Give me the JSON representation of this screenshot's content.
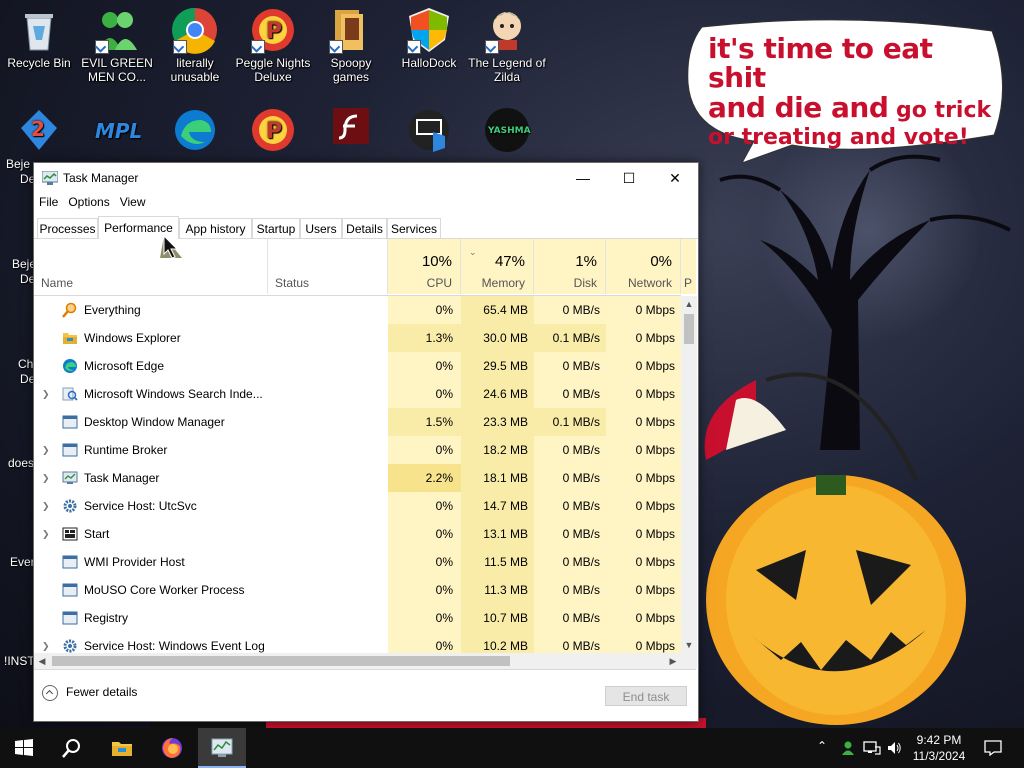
{
  "desktop": {
    "icons": [
      {
        "label": "Recycle Bin",
        "icon": "recycle-bin-icon"
      },
      {
        "label": "EVIL GREEN MEN CO...",
        "icon": "green-men-icon"
      },
      {
        "label": "literally unusable",
        "icon": "chrome-icon"
      },
      {
        "label": "Peggle Nights Deluxe",
        "icon": "peggle-icon"
      },
      {
        "label": "Spoopy games",
        "icon": "folder-icon"
      },
      {
        "label": "HalloDock",
        "icon": "shield-icon"
      },
      {
        "label": "The Legend of Zilda",
        "icon": "zilda-icon"
      }
    ],
    "left_partial_labels": [
      "Beje",
      "De",
      "Beje",
      "De",
      "Ch",
      "De",
      "does",
      "Ever",
      "!INST"
    ],
    "speech_bubble": {
      "line1": "it's time to eat shit",
      "line2a": "and die and",
      "line2b": " go trick",
      "line3": "or treating and vote!"
    }
  },
  "taskmanager": {
    "title": "Task Manager",
    "controls": {
      "minimize": "—",
      "maximize": "☐",
      "close": "✕"
    },
    "menu": [
      "File",
      "Options",
      "View"
    ],
    "tabs": [
      "Processes",
      "Performance",
      "App history",
      "Startup",
      "Users",
      "Details",
      "Services"
    ],
    "active_tab": "Performance",
    "columns": {
      "name": "Name",
      "status": "Status",
      "cpu": {
        "pct": "10%",
        "label": "CPU"
      },
      "memory": {
        "pct": "47%",
        "label": "Memory"
      },
      "disk": {
        "pct": "1%",
        "label": "Disk"
      },
      "network": {
        "pct": "0%",
        "label": "Network"
      },
      "power_partial": "P"
    },
    "processes": [
      {
        "name": "Everything",
        "expand": false,
        "icon": "magnifier-icon",
        "cpu": "0%",
        "mem": "65.4 MB",
        "disk": "0 MB/s",
        "net": "0 Mbps"
      },
      {
        "name": "Windows Explorer",
        "expand": false,
        "icon": "folder-icon",
        "cpu": "1.3%",
        "mem": "30.0 MB",
        "disk": "0.1 MB/s",
        "net": "0 Mbps"
      },
      {
        "name": "Microsoft Edge",
        "expand": false,
        "icon": "edge-icon",
        "cpu": "0%",
        "mem": "29.5 MB",
        "disk": "0 MB/s",
        "net": "0 Mbps"
      },
      {
        "name": "Microsoft Windows Search Inde...",
        "expand": true,
        "icon": "search-indexer-icon",
        "cpu": "0%",
        "mem": "24.6 MB",
        "disk": "0 MB/s",
        "net": "0 Mbps"
      },
      {
        "name": "Desktop Window Manager",
        "expand": false,
        "icon": "window-icon",
        "cpu": "1.5%",
        "mem": "23.3 MB",
        "disk": "0.1 MB/s",
        "net": "0 Mbps"
      },
      {
        "name": "Runtime Broker",
        "expand": true,
        "icon": "window-icon",
        "cpu": "0%",
        "mem": "18.2 MB",
        "disk": "0 MB/s",
        "net": "0 Mbps"
      },
      {
        "name": "Task Manager",
        "expand": true,
        "icon": "task-manager-icon",
        "cpu": "2.2%",
        "mem": "18.1 MB",
        "disk": "0 MB/s",
        "net": "0 Mbps"
      },
      {
        "name": "Service Host: UtcSvc",
        "expand": true,
        "icon": "gear-icon",
        "cpu": "0%",
        "mem": "14.7 MB",
        "disk": "0 MB/s",
        "net": "0 Mbps"
      },
      {
        "name": "Start",
        "expand": true,
        "icon": "start-icon",
        "cpu": "0%",
        "mem": "13.1 MB",
        "disk": "0 MB/s",
        "net": "0 Mbps"
      },
      {
        "name": "WMI Provider Host",
        "expand": false,
        "icon": "window-icon",
        "cpu": "0%",
        "mem": "11.5 MB",
        "disk": "0 MB/s",
        "net": "0 Mbps"
      },
      {
        "name": "MoUSO Core Worker Process",
        "expand": false,
        "icon": "window-icon",
        "cpu": "0%",
        "mem": "11.3 MB",
        "disk": "0 MB/s",
        "net": "0 Mbps"
      },
      {
        "name": "Registry",
        "expand": false,
        "icon": "window-icon",
        "cpu": "0%",
        "mem": "10.7 MB",
        "disk": "0 MB/s",
        "net": "0 Mbps"
      },
      {
        "name": "Service Host: Windows Event Log",
        "expand": true,
        "icon": "gear-icon",
        "cpu": "0%",
        "mem": "10.2 MB",
        "disk": "0 MB/s",
        "net": "0 Mbps"
      }
    ],
    "fewer_details": "Fewer details",
    "end_task": "End task"
  },
  "taskbar": {
    "time": "9:42 PM",
    "date": "11/3/2024",
    "apps": [
      "start-icon",
      "search-icon",
      "file-explorer-icon",
      "firefox-icon",
      "task-manager-icon"
    ]
  },
  "colors": {
    "heat_light": "#fff4c4",
    "heat_mid": "#f9eca8",
    "heat_high": "#f6e38c",
    "accent_red": "#c8102e"
  }
}
